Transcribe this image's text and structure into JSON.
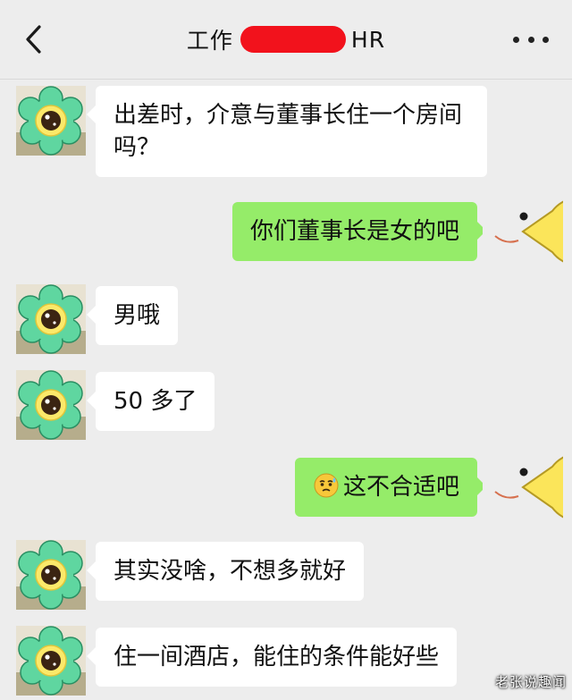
{
  "header": {
    "title_prefix": "工作",
    "title_suffix": "HR",
    "back_icon": "chevron-left-icon",
    "more_icon": "more-dots-icon",
    "redaction_color": "#f2121c"
  },
  "colors": {
    "background": "#ededed",
    "incoming_bubble": "#ffffff",
    "outgoing_bubble": "#95ec69"
  },
  "messages": [
    {
      "side": "in",
      "text": "出差时，介意与董事长住一个房间吗？"
    },
    {
      "side": "out",
      "text": "你们董事长是女的吧"
    },
    {
      "side": "in",
      "text": "男哦"
    },
    {
      "side": "in",
      "text": "50 多了"
    },
    {
      "side": "out",
      "emoji": "sweating-face-emoji",
      "text": "这不合适吧"
    },
    {
      "side": "in",
      "text": "其实没啥，不想多就好"
    },
    {
      "side": "in",
      "text": "住一间酒店，能住的条件能好些"
    }
  ],
  "avatars": {
    "contact": "flower-avatar",
    "self": "pacman-avatar"
  },
  "watermark": "老张说趣闻"
}
